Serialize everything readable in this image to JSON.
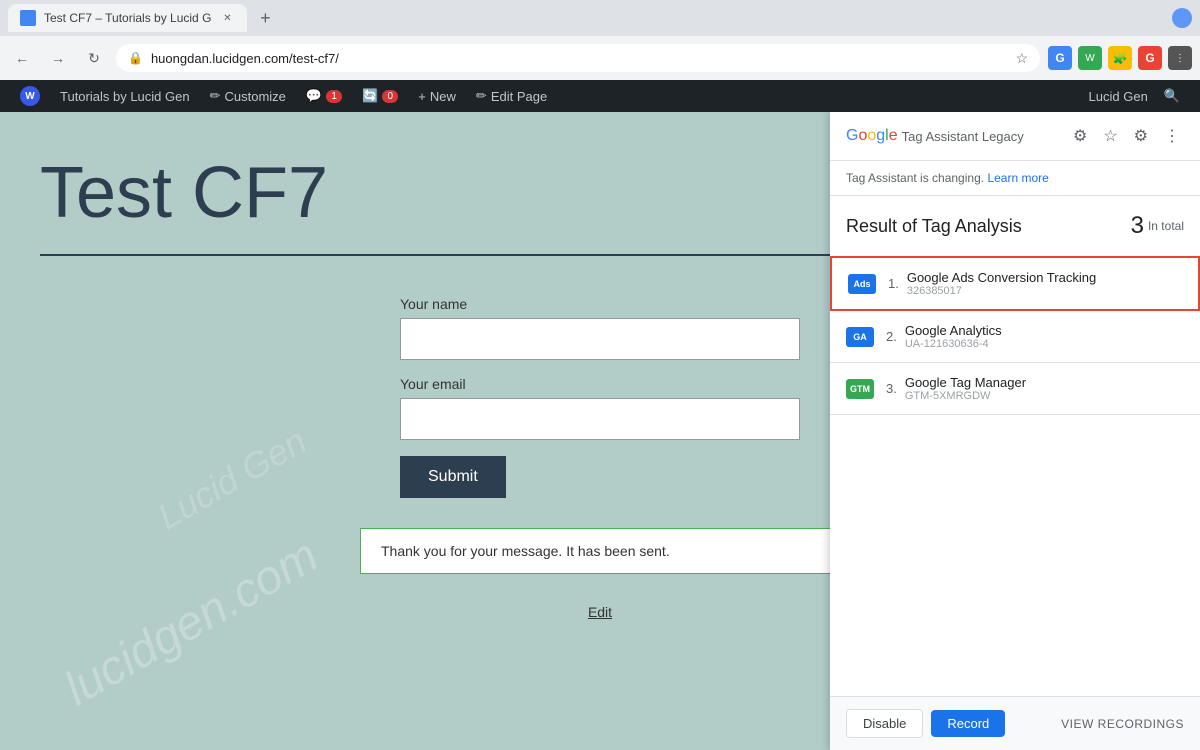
{
  "browser": {
    "tab_title": "Test CF7 – Tutorials by Lucid G",
    "url": "huongdan.lucidgen.com/test-cf7/",
    "new_tab_symbol": "+",
    "back_symbol": "←",
    "forward_symbol": "→",
    "refresh_symbol": "↻"
  },
  "admin_bar": {
    "site_title": "Tutorials by Lucid Gen",
    "customize_label": "Customize",
    "comments_count": "1",
    "updates_count": "0",
    "new_label": "New",
    "edit_page_label": "Edit Page",
    "top_right_label": "Lucid Gen"
  },
  "page": {
    "title": "Test CF7",
    "your_name_label": "Your name",
    "your_email_label": "Your email",
    "submit_label": "Submit",
    "success_message": "Thank you for your message. It has been sent.",
    "edit_link": "Edit",
    "watermark1": "lucidgen.com",
    "watermark2": "Lucid Gen"
  },
  "tag_assistant": {
    "google_text": "Google",
    "panel_title": "Tag Assistant Legacy",
    "notice_text": "Tag Assistant is changing.",
    "learn_more_text": "Learn more",
    "result_title": "Result of Tag Analysis",
    "total_count": "3",
    "total_label": "In total",
    "tags": [
      {
        "number": "1.",
        "name": "Google Ads Conversion Tracking",
        "id": "326385017",
        "type": "ads",
        "selected": true
      },
      {
        "number": "2.",
        "name": "Google Analytics",
        "id": "UA-121630636-4",
        "type": "analytics",
        "selected": false
      },
      {
        "number": "3.",
        "name": "Google Tag Manager",
        "id": "GTM-5XMRGDW",
        "type": "gtm",
        "selected": false
      }
    ],
    "disable_label": "Disable",
    "record_label": "Record",
    "view_recordings_label": "VIEW RECORDINGS"
  }
}
